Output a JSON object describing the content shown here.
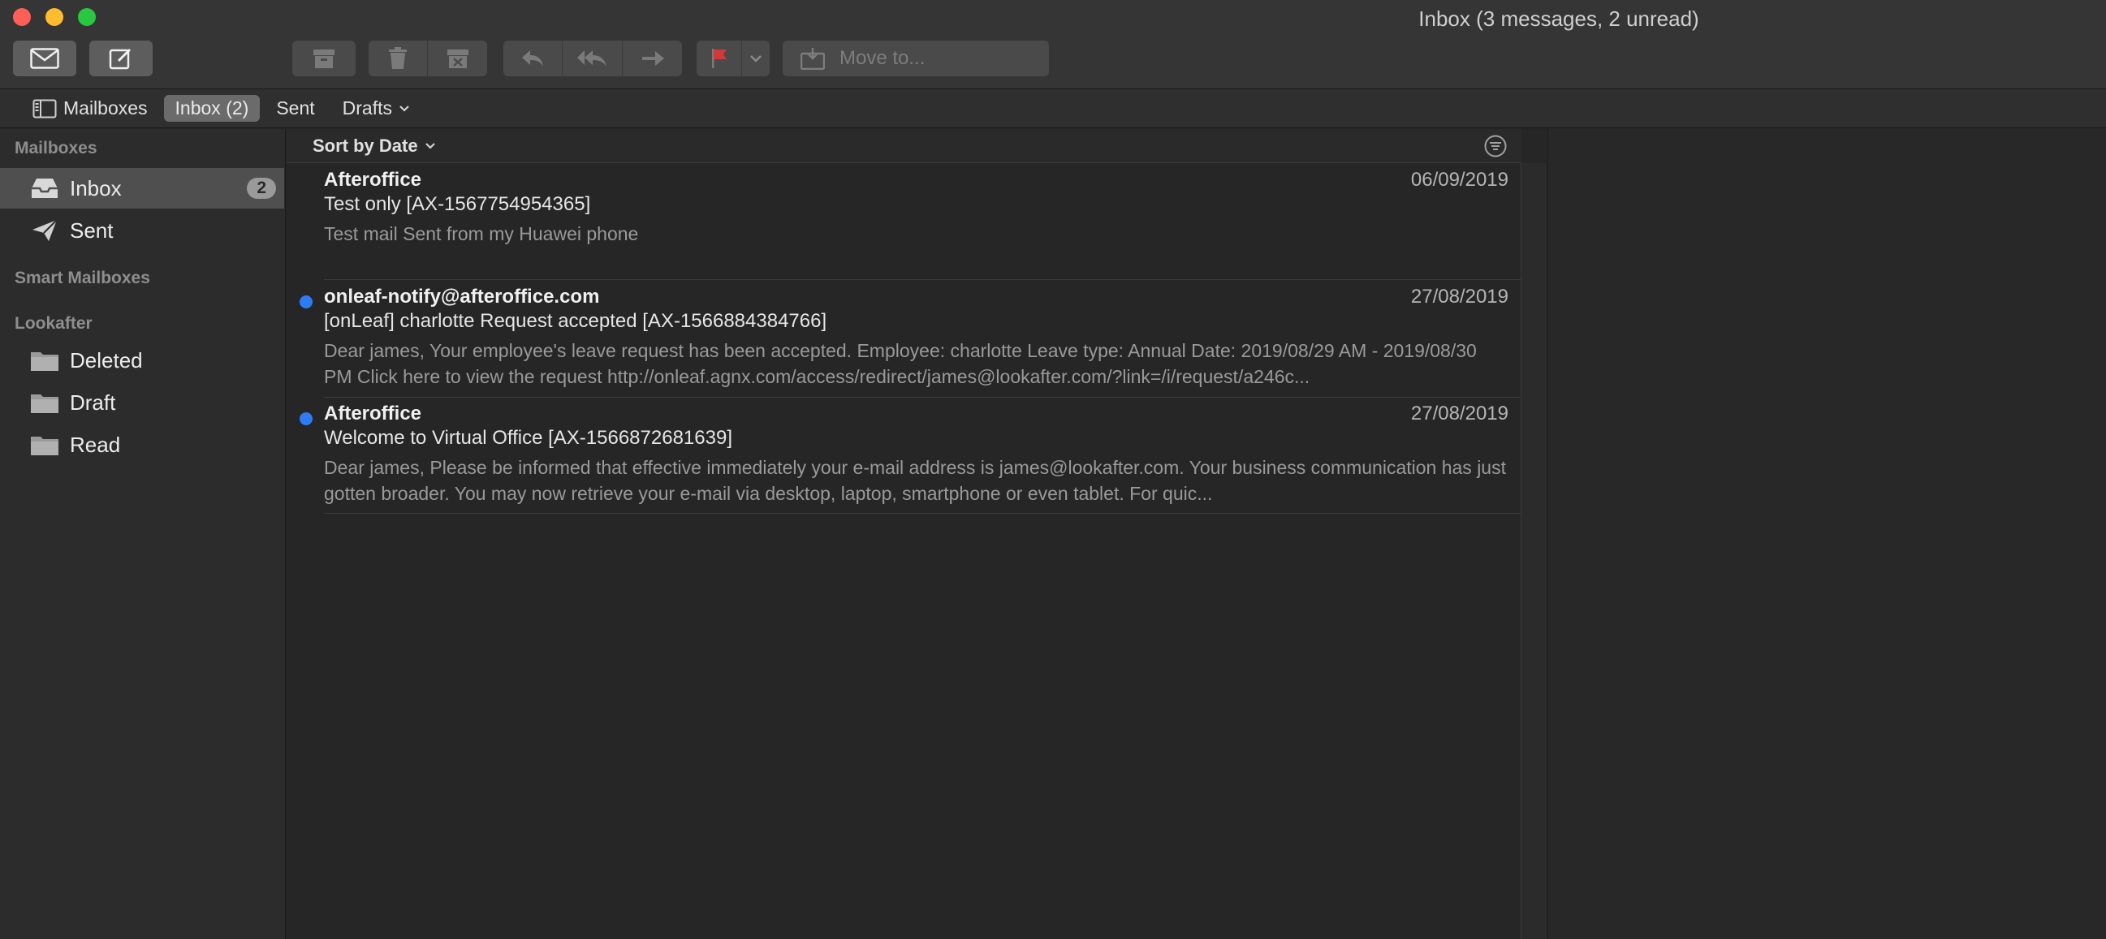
{
  "window": {
    "title": "Inbox (3 messages, 2 unread)"
  },
  "toolbar": {
    "moveto_label": "Move to...",
    "icons": [
      "get-mail-icon",
      "compose-icon",
      "archive-icon",
      "trash-icon",
      "junk-icon",
      "reply-icon",
      "reply-all-icon",
      "forward-icon",
      "flag-icon",
      "chevron-down-icon",
      "move-icon"
    ]
  },
  "favorites": [
    {
      "label": "Mailboxes"
    },
    {
      "label": "Inbox (2)"
    },
    {
      "label": "Sent"
    },
    {
      "label": "Drafts"
    }
  ],
  "sidebar": {
    "sections": [
      "Mailboxes",
      "Smart Mailboxes",
      "Lookafter"
    ],
    "mailboxes": [
      {
        "label": "Inbox",
        "badge": "2"
      },
      {
        "label": "Sent"
      }
    ],
    "lookafter": [
      {
        "label": "Deleted"
      },
      {
        "label": "Draft"
      },
      {
        "label": "Read"
      }
    ]
  },
  "list": {
    "sort_label": "Sort by Date",
    "messages": [
      {
        "from": "Afteroffice",
        "date": "06/09/2019",
        "subject": "Test only [AX-1567754954365]",
        "preview": "Test mail Sent from my Huawei phone",
        "unread": false
      },
      {
        "from": "onleaf-notify@afteroffice.com",
        "date": "27/08/2019",
        "subject": "[onLeaf] charlotte Request accepted [AX-1566884384766]",
        "preview": "Dear james, Your employee's leave request has been accepted. Employee: charlotte Leave type: Annual Date: 2019/08/29 AM - 2019/08/30 PM Click here to view the request http://onleaf.agnx.com/access/redirect/james@lookafter.com/?link=/i/request/a246c...",
        "unread": true
      },
      {
        "from": "Afteroffice",
        "date": "27/08/2019",
        "subject": "Welcome to Virtual Office [AX-1566872681639]",
        "preview": "Dear james, Please be informed that effective immediately your e-mail address is james@lookafter.com. Your business communication has just gotten broader. You may now retrieve your e-mail via desktop, laptop, smartphone or even tablet. For quic...",
        "unread": true
      }
    ]
  },
  "colors": {
    "unread_dot": "#2f7bf5",
    "flag": "#d23a3a",
    "background": "#262626"
  }
}
